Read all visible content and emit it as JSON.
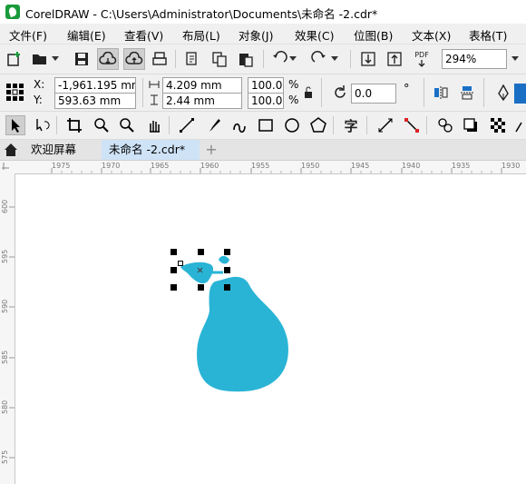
{
  "window": {
    "title": "CorelDRAW - C:\\Users\\Administrator\\Documents\\未命名 -2.cdr*"
  },
  "menu": [
    {
      "label": "文件(F)"
    },
    {
      "label": "编辑(E)"
    },
    {
      "label": "查看(V)"
    },
    {
      "label": "布局(L)"
    },
    {
      "label": "对象(J)"
    },
    {
      "label": "效果(C)"
    },
    {
      "label": "位图(B)"
    },
    {
      "label": "文本(X)"
    },
    {
      "label": "表格(T)"
    }
  ],
  "toolbar": {
    "zoom": "294%",
    "pdf_label": "PDF"
  },
  "property_bar": {
    "x_label": "X:",
    "y_label": "Y:",
    "x_value": "-1,961.195 mm",
    "y_value": "593.63 mm",
    "width": "4.209 mm",
    "height": "2.44 mm",
    "scale_w": "100.0",
    "scale_h": "100.0",
    "percent": "%",
    "rotation": "0.0",
    "degree": "°"
  },
  "toolbox": {
    "text_tool": "字"
  },
  "tabs": [
    {
      "label": "欢迎屏幕"
    },
    {
      "label": "未命名 -2.cdr*"
    }
  ],
  "rulers": {
    "horizontal": [
      "1975",
      "1970",
      "1965",
      "1960",
      "1955",
      "1950",
      "1945",
      "1940",
      "1935",
      "1930"
    ],
    "vertical": [
      "600",
      "595",
      "590",
      "585",
      "580",
      "575"
    ]
  },
  "colors": {
    "shape_fill": "#29b4d6",
    "selection": "#000000"
  }
}
